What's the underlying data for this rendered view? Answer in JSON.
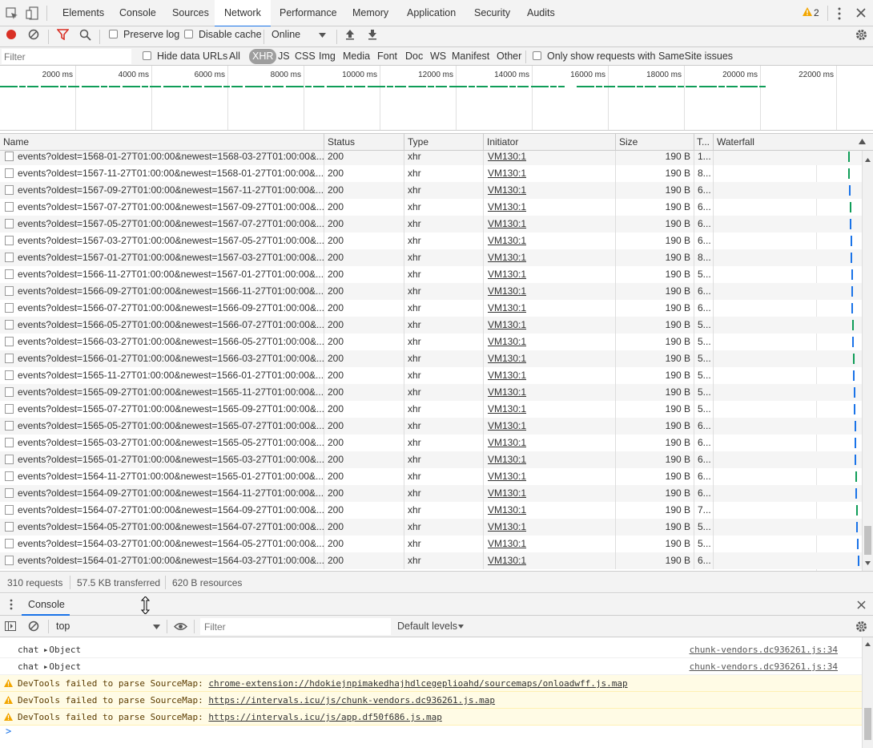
{
  "tabs": [
    {
      "label": "Elements"
    },
    {
      "label": "Console"
    },
    {
      "label": "Sources"
    },
    {
      "label": "Network"
    },
    {
      "label": "Performance"
    },
    {
      "label": "Memory"
    },
    {
      "label": "Application"
    },
    {
      "label": "Security"
    },
    {
      "label": "Audits"
    }
  ],
  "active_tab": "Network",
  "warning_count": "2",
  "toolbar": {
    "preserve_log": "Preserve log",
    "disable_cache": "Disable cache",
    "throttle_value": "Online"
  },
  "filterbar": {
    "placeholder": "Filter",
    "hide_data_urls": "Hide data URLs",
    "types": [
      "All",
      "XHR",
      "JS",
      "CSS",
      "Img",
      "Media",
      "Font",
      "Doc",
      "WS",
      "Manifest",
      "Other"
    ],
    "active_type": "XHR",
    "samesite": "Only show requests with SameSite issues"
  },
  "overview": {
    "ticks": [
      "2000 ms",
      "4000 ms",
      "6000 ms",
      "8000 ms",
      "10000 ms",
      "12000 ms",
      "14000 ms",
      "16000 ms",
      "18000 ms",
      "20000 ms",
      "22000 ms"
    ]
  },
  "table": {
    "headers": {
      "name": "Name",
      "status": "Status",
      "type": "Type",
      "initiator": "Initiator",
      "size": "Size",
      "time": "T...",
      "waterfall": "Waterfall"
    },
    "rows": [
      {
        "name": "events?oldest=1568-01-27T01:00:00&newest=1568-03-27T01:00:00&...",
        "status": "200",
        "type": "xhr",
        "initiator": "VM130:1",
        "size": "190 B",
        "time": "1..."
      },
      {
        "name": "events?oldest=1567-11-27T01:00:00&newest=1568-01-27T01:00:00&...",
        "status": "200",
        "type": "xhr",
        "initiator": "VM130:1",
        "size": "190 B",
        "time": "8..."
      },
      {
        "name": "events?oldest=1567-09-27T01:00:00&newest=1567-11-27T01:00:00&...",
        "status": "200",
        "type": "xhr",
        "initiator": "VM130:1",
        "size": "190 B",
        "time": "6..."
      },
      {
        "name": "events?oldest=1567-07-27T01:00:00&newest=1567-09-27T01:00:00&...",
        "status": "200",
        "type": "xhr",
        "initiator": "VM130:1",
        "size": "190 B",
        "time": "6..."
      },
      {
        "name": "events?oldest=1567-05-27T01:00:00&newest=1567-07-27T01:00:00&...",
        "status": "200",
        "type": "xhr",
        "initiator": "VM130:1",
        "size": "190 B",
        "time": "6..."
      },
      {
        "name": "events?oldest=1567-03-27T01:00:00&newest=1567-05-27T01:00:00&...",
        "status": "200",
        "type": "xhr",
        "initiator": "VM130:1",
        "size": "190 B",
        "time": "6..."
      },
      {
        "name": "events?oldest=1567-01-27T01:00:00&newest=1567-03-27T01:00:00&...",
        "status": "200",
        "type": "xhr",
        "initiator": "VM130:1",
        "size": "190 B",
        "time": "8..."
      },
      {
        "name": "events?oldest=1566-11-27T01:00:00&newest=1567-01-27T01:00:00&...",
        "status": "200",
        "type": "xhr",
        "initiator": "VM130:1",
        "size": "190 B",
        "time": "5..."
      },
      {
        "name": "events?oldest=1566-09-27T01:00:00&newest=1566-11-27T01:00:00&...",
        "status": "200",
        "type": "xhr",
        "initiator": "VM130:1",
        "size": "190 B",
        "time": "6..."
      },
      {
        "name": "events?oldest=1566-07-27T01:00:00&newest=1566-09-27T01:00:00&...",
        "status": "200",
        "type": "xhr",
        "initiator": "VM130:1",
        "size": "190 B",
        "time": "6..."
      },
      {
        "name": "events?oldest=1566-05-27T01:00:00&newest=1566-07-27T01:00:00&...",
        "status": "200",
        "type": "xhr",
        "initiator": "VM130:1",
        "size": "190 B",
        "time": "5..."
      },
      {
        "name": "events?oldest=1566-03-27T01:00:00&newest=1566-05-27T01:00:00&...",
        "status": "200",
        "type": "xhr",
        "initiator": "VM130:1",
        "size": "190 B",
        "time": "5..."
      },
      {
        "name": "events?oldest=1566-01-27T01:00:00&newest=1566-03-27T01:00:00&...",
        "status": "200",
        "type": "xhr",
        "initiator": "VM130:1",
        "size": "190 B",
        "time": "5..."
      },
      {
        "name": "events?oldest=1565-11-27T01:00:00&newest=1566-01-27T01:00:00&...",
        "status": "200",
        "type": "xhr",
        "initiator": "VM130:1",
        "size": "190 B",
        "time": "5..."
      },
      {
        "name": "events?oldest=1565-09-27T01:00:00&newest=1565-11-27T01:00:00&...",
        "status": "200",
        "type": "xhr",
        "initiator": "VM130:1",
        "size": "190 B",
        "time": "5..."
      },
      {
        "name": "events?oldest=1565-07-27T01:00:00&newest=1565-09-27T01:00:00&...",
        "status": "200",
        "type": "xhr",
        "initiator": "VM130:1",
        "size": "190 B",
        "time": "5..."
      },
      {
        "name": "events?oldest=1565-05-27T01:00:00&newest=1565-07-27T01:00:00&...",
        "status": "200",
        "type": "xhr",
        "initiator": "VM130:1",
        "size": "190 B",
        "time": "6..."
      },
      {
        "name": "events?oldest=1565-03-27T01:00:00&newest=1565-05-27T01:00:00&...",
        "status": "200",
        "type": "xhr",
        "initiator": "VM130:1",
        "size": "190 B",
        "time": "6..."
      },
      {
        "name": "events?oldest=1565-01-27T01:00:00&newest=1565-03-27T01:00:00&...",
        "status": "200",
        "type": "xhr",
        "initiator": "VM130:1",
        "size": "190 B",
        "time": "6..."
      },
      {
        "name": "events?oldest=1564-11-27T01:00:00&newest=1565-01-27T01:00:00&...",
        "status": "200",
        "type": "xhr",
        "initiator": "VM130:1",
        "size": "190 B",
        "time": "6..."
      },
      {
        "name": "events?oldest=1564-09-27T01:00:00&newest=1564-11-27T01:00:00&...",
        "status": "200",
        "type": "xhr",
        "initiator": "VM130:1",
        "size": "190 B",
        "time": "6..."
      },
      {
        "name": "events?oldest=1564-07-27T01:00:00&newest=1564-09-27T01:00:00&...",
        "status": "200",
        "type": "xhr",
        "initiator": "VM130:1",
        "size": "190 B",
        "time": "7..."
      },
      {
        "name": "events?oldest=1564-05-27T01:00:00&newest=1564-07-27T01:00:00&...",
        "status": "200",
        "type": "xhr",
        "initiator": "VM130:1",
        "size": "190 B",
        "time": "5..."
      },
      {
        "name": "events?oldest=1564-03-27T01:00:00&newest=1564-05-27T01:00:00&...",
        "status": "200",
        "type": "xhr",
        "initiator": "VM130:1",
        "size": "190 B",
        "time": "5..."
      },
      {
        "name": "events?oldest=1564-01-27T01:00:00&newest=1564-03-27T01:00:00&...",
        "status": "200",
        "type": "xhr",
        "initiator": "VM130:1",
        "size": "190 B",
        "time": "6..."
      }
    ]
  },
  "status": {
    "requests": "310 requests",
    "transferred": "57.5 KB transferred",
    "resources": "620 B resources"
  },
  "drawer": {
    "tab": "Console",
    "context": "top",
    "filter_placeholder": "Filter",
    "levels": "Default levels"
  },
  "console": {
    "messages": [
      {
        "kind": "log",
        "prefix": "chat ",
        "obj": "Object",
        "source": "chunk-vendors.dc936261.js:34"
      },
      {
        "kind": "log",
        "prefix": "chat ",
        "obj": "Object",
        "source": "chunk-vendors.dc936261.js:34"
      },
      {
        "kind": "warn",
        "prefix": "DevTools failed to parse SourceMap: ",
        "link": "chrome-extension://hdokiejnpimakedhajhdlcegeplioahd/sourcemaps/onloadwff.js.map"
      },
      {
        "kind": "warn",
        "prefix": "DevTools failed to parse SourceMap: ",
        "link": "https://intervals.icu/js/chunk-vendors.dc936261.js.map"
      },
      {
        "kind": "warn",
        "prefix": "DevTools failed to parse SourceMap: ",
        "link": "https://intervals.icu/js/app.df50f686.js.map"
      }
    ],
    "prompt": ">"
  },
  "colors": {
    "accent": "#1a73e8",
    "record": "#d93025",
    "filter": "#d93025",
    "waterfall_green": "#0f9d58",
    "waterfall_blue": "#1a73e8",
    "overview_green": "#0f9d58"
  }
}
